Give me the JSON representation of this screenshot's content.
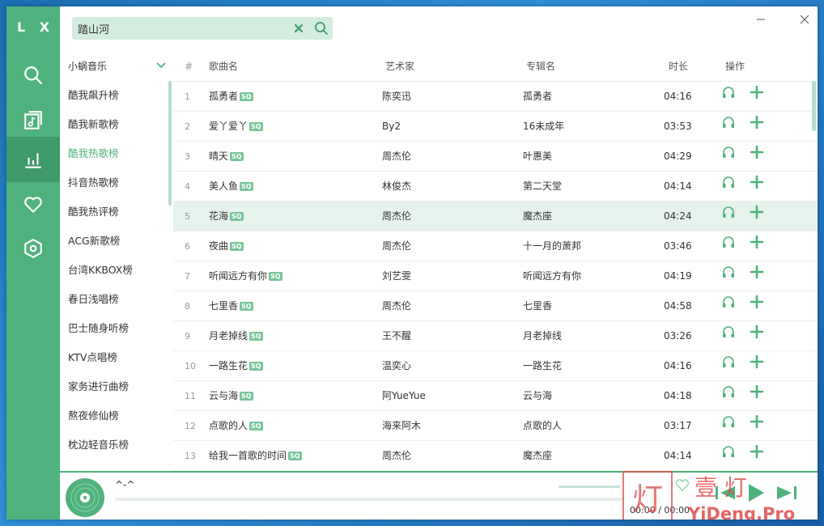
{
  "app": {
    "logo": "L X"
  },
  "search": {
    "value": "踏山河"
  },
  "sidebar": {
    "source_label": "小蜗音乐",
    "lists": [
      "酷我飙升榜",
      "酷我新歌榜",
      "酷我热歌榜",
      "抖音热歌榜",
      "酷我热评榜",
      "ACG新歌榜",
      "台湾KKBOX榜",
      "春日浅唱榜",
      "巴士随身听榜",
      "KTV点唱榜",
      "家务进行曲榜",
      "熬夜修仙榜",
      "枕边轻音乐榜"
    ],
    "active_index": 2
  },
  "table": {
    "headers": {
      "num": "#",
      "name": "歌曲名",
      "artist": "艺术家",
      "album": "专辑名",
      "duration": "时长",
      "ops": "操作"
    },
    "quality_badge": "SQ",
    "selected_index": 4,
    "rows": [
      {
        "num": "1",
        "name": "孤勇者",
        "artist": "陈奕迅",
        "album": "孤勇者",
        "duration": "04:16"
      },
      {
        "num": "2",
        "name": "爱丫爱丫",
        "artist": "By2",
        "album": "16未成年",
        "duration": "03:53"
      },
      {
        "num": "3",
        "name": "晴天",
        "artist": "周杰伦",
        "album": "叶惠美",
        "duration": "04:29"
      },
      {
        "num": "4",
        "name": "美人鱼",
        "artist": "林俊杰",
        "album": "第二天堂",
        "duration": "04:14"
      },
      {
        "num": "5",
        "name": "花海",
        "artist": "周杰伦",
        "album": "魔杰座",
        "duration": "04:24"
      },
      {
        "num": "6",
        "name": "夜曲",
        "artist": "周杰伦",
        "album": "十一月的萧邦",
        "duration": "03:46"
      },
      {
        "num": "7",
        "name": "听闻远方有你",
        "artist": "刘艺雯",
        "album": "听闻远方有你",
        "duration": "04:19"
      },
      {
        "num": "8",
        "name": "七里香",
        "artist": "周杰伦",
        "album": "七里香",
        "duration": "04:58"
      },
      {
        "num": "9",
        "name": "月老掉线",
        "artist": "王不醒",
        "album": "月老掉线",
        "duration": "03:26"
      },
      {
        "num": "10",
        "name": "一路生花",
        "artist": "温奕心",
        "album": "一路生花",
        "duration": "04:16"
      },
      {
        "num": "11",
        "name": "云与海",
        "artist": "阿YueYue",
        "album": "云与海",
        "duration": "04:18"
      },
      {
        "num": "12",
        "name": "点歌的人",
        "artist": "海来阿木",
        "album": "点歌的人",
        "duration": "03:17"
      },
      {
        "num": "13",
        "name": "给我一首歌的时间",
        "artist": "周杰伦",
        "album": "魔杰座",
        "duration": "04:14"
      }
    ]
  },
  "player": {
    "title": "^-^",
    "time_current": "00:00",
    "time_separator": "/",
    "time_total": "00:00"
  },
  "watermark": {
    "brand": "壹 灯",
    "url": "YiDeng.Pro"
  },
  "colors": {
    "accent": "#4fb27d",
    "accent_dark": "#3e9a69",
    "badge": "#78c49a",
    "watermark": "#e14b4b"
  },
  "icons": {
    "rail": [
      "search-icon",
      "song-list-icon",
      "leaderboard-icon",
      "heart-icon",
      "settings-icon"
    ],
    "row_ops": [
      "headphones-icon",
      "plus-icon"
    ]
  }
}
